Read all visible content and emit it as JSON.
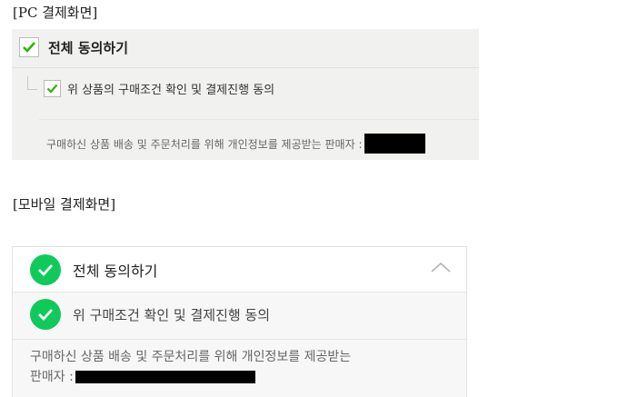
{
  "captions": {
    "pc": "[PC 결제화면]",
    "mobile": "[모바일 결제화면]"
  },
  "pc": {
    "agree_all_label": "전체 동의하기",
    "agree_all_checked": true,
    "purchase_agree_label": "위 상품의 구매조건 확인 및 결제진행 동의",
    "purchase_agree_checked": true,
    "seller_info_text": "구매하신 상품 배송 및 주문처리를 위해 개인정보를 제공받는 판매자 :"
  },
  "mobile": {
    "agree_all_label": "전체 동의하기",
    "agree_all_checked": true,
    "purchase_agree_label": "위 구매조건 확인 및 결제진행 동의",
    "purchase_agree_checked": true,
    "seller_info_line1": "구매하신 상품 배송 및 주문처리를 위해 개인정보를 제공받는",
    "seller_info_line2": "판매자 :"
  },
  "colors": {
    "check_green": "#0fca5a",
    "pc_check": "#2db400",
    "redaction": "#000000"
  },
  "icons": {
    "pc_checkbox": "checkmark-icon",
    "mobile_check": "check-circle-icon",
    "collapse": "chevron-up-icon"
  }
}
